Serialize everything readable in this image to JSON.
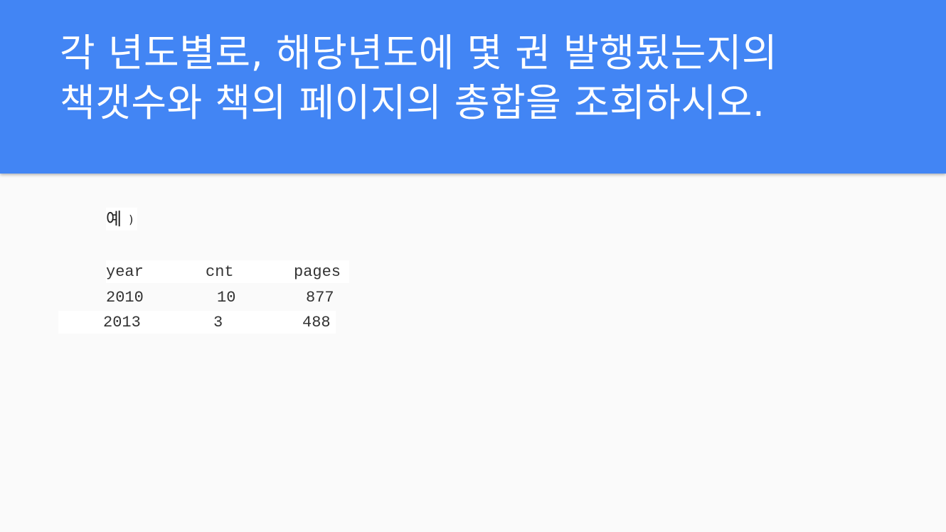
{
  "title": {
    "line1": "각 년도별로, 해당년도에 몇 권 발행됬는지의",
    "line2": "책갯수와 책의 페이지의 총합을 조회하시오."
  },
  "example": {
    "label": "예",
    "paren": ")"
  },
  "table": {
    "headers": [
      "year",
      "cnt",
      "pages"
    ],
    "rows": [
      [
        "2010",
        "10",
        "877"
      ],
      [
        "2013",
        "3",
        "488"
      ]
    ]
  },
  "colors": {
    "header_bg": "#4285f4",
    "title_text": "#ffffff",
    "page_bg": "#fafafa"
  }
}
